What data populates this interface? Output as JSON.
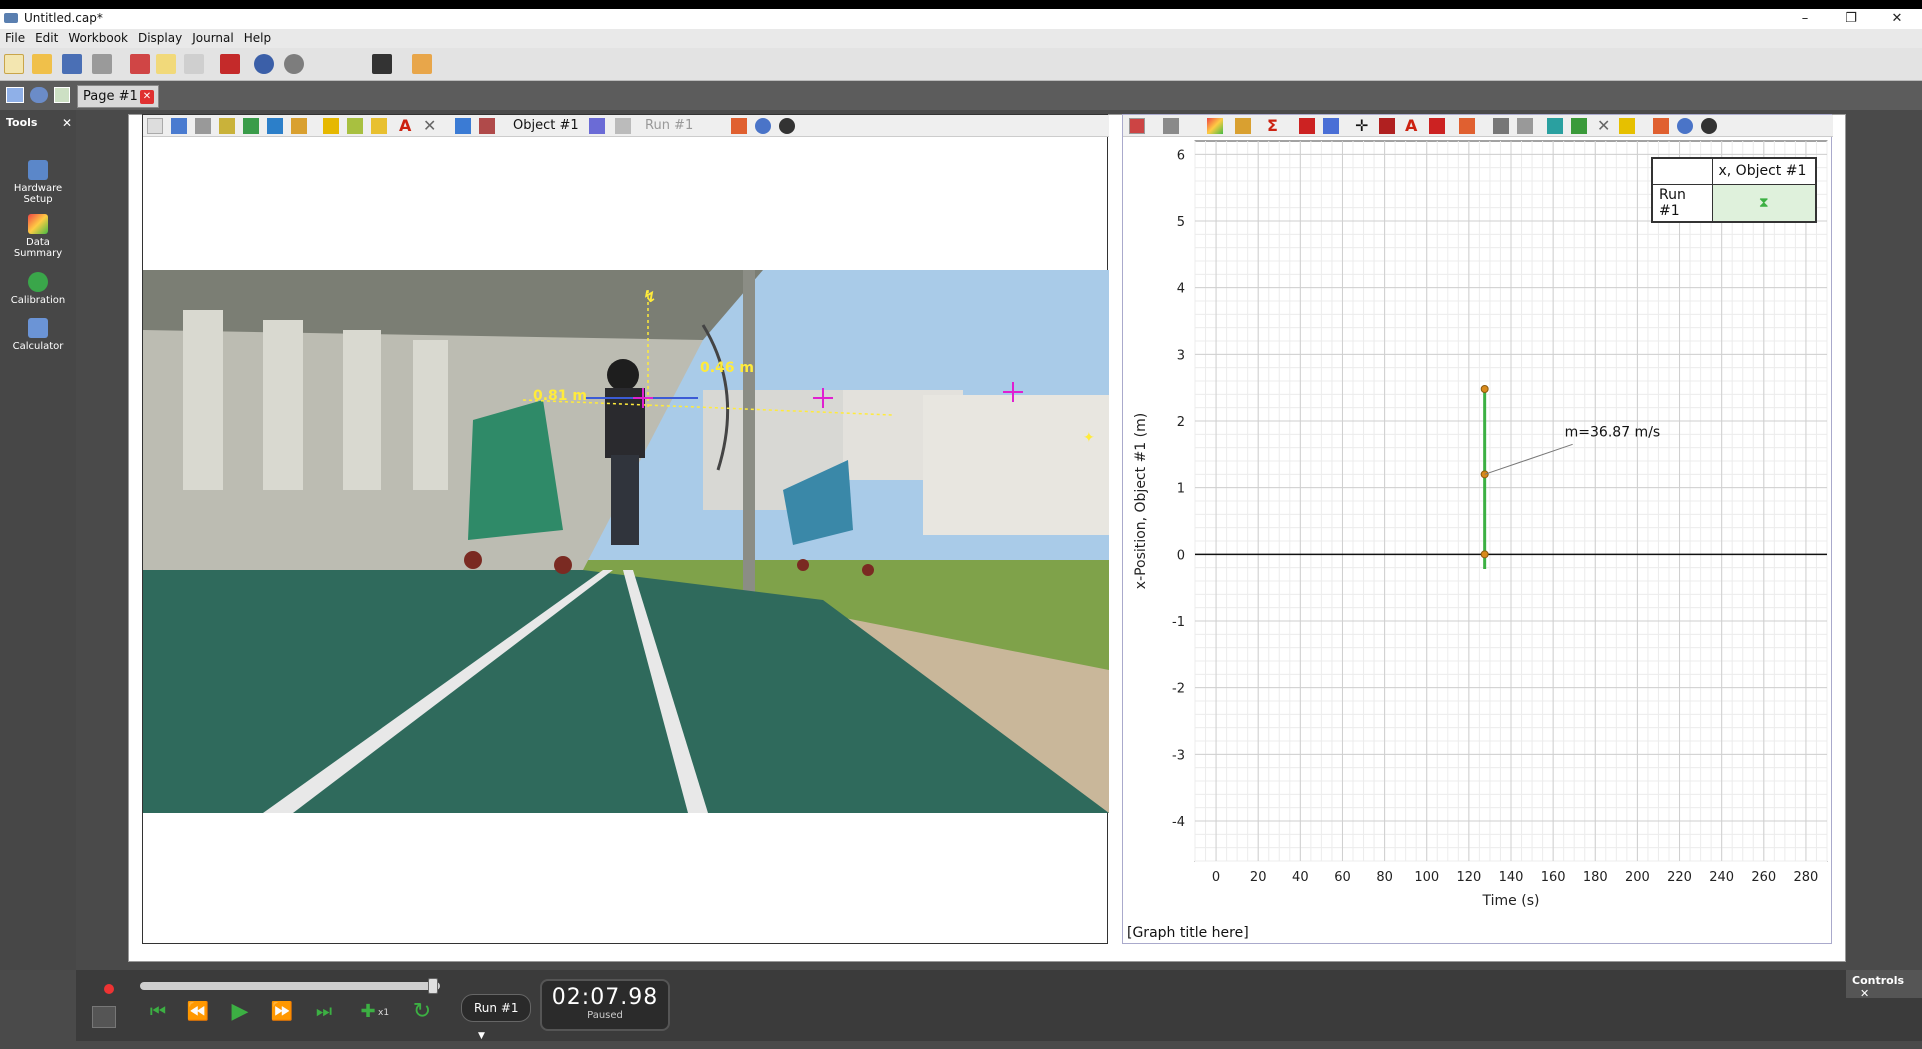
{
  "window": {
    "title": "Untitled.cap*",
    "minimize": "–",
    "maximize": "❐",
    "close": "✕"
  },
  "menu": [
    "File",
    "Edit",
    "Workbook",
    "Display",
    "Journal",
    "Help"
  ],
  "page_tab": {
    "label": "Page #1"
  },
  "tools": {
    "header": "Tools",
    "items": [
      {
        "label": "Hardware Setup",
        "icon": "hardware-setup-icon"
      },
      {
        "label": "Data Summary",
        "icon": "data-summary-icon"
      },
      {
        "label": "Calibration",
        "icon": "calibration-icon"
      },
      {
        "label": "Calculator",
        "icon": "calculator-icon"
      }
    ]
  },
  "video": {
    "object_label": "Object #1",
    "run_label": "Run #1",
    "measure_1": "0.81 m",
    "measure_2": "0.46 m"
  },
  "graph": {
    "legend_header": "x, Object #1",
    "legend_run": "Run #1",
    "legend_symbol": "⧗",
    "annotation": "m=36.87 m/s",
    "title_placeholder": "[Graph title here]"
  },
  "chart_data": {
    "type": "line",
    "xlabel": "Time (s)",
    "ylabel": "x-Position, Object #1 (m)",
    "xlim": [
      -10,
      290
    ],
    "ylim": [
      -4.6,
      6.2
    ],
    "xticks": [
      0,
      20,
      40,
      60,
      80,
      100,
      120,
      140,
      160,
      180,
      200,
      220,
      240,
      260,
      280
    ],
    "yticks": [
      -4,
      -3,
      -2,
      -1,
      0,
      1,
      2,
      3,
      4,
      5,
      6
    ],
    "series": [
      {
        "name": "Run #1",
        "color": "#3cb043",
        "points": [
          [
            127.5,
            0.0
          ],
          [
            127.5,
            1.2
          ],
          [
            127.5,
            2.48
          ]
        ]
      }
    ],
    "annotation": {
      "text": "m=36.87 m/s",
      "x": 127.5,
      "y": 1.2
    },
    "grid": true
  },
  "controls": {
    "header": "Controls",
    "run_select": "Run #1",
    "time": "02:07.98",
    "status": "Paused",
    "speed": "x1"
  }
}
